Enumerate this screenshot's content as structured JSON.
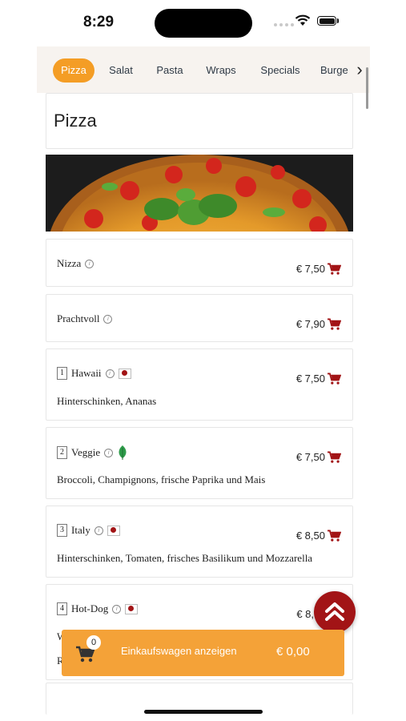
{
  "status_bar": {
    "time": "8:29"
  },
  "categories": [
    {
      "label": "Pizza",
      "active": true
    },
    {
      "label": "Salat",
      "active": false
    },
    {
      "label": "Pasta",
      "active": false
    },
    {
      "label": "Wraps",
      "active": false
    },
    {
      "label": "Specials",
      "active": false
    },
    {
      "label": "Burge",
      "active": false
    }
  ],
  "section": {
    "title": "Pizza"
  },
  "items": [
    {
      "name": "Nizza",
      "price": "€ 7,50"
    },
    {
      "name": "Prachtvoll",
      "price": "€ 7,90"
    },
    {
      "number": "1",
      "name": "Hawaii",
      "description": "Hinterschinken, Ananas",
      "price": "€ 7,50"
    },
    {
      "number": "2",
      "name": "Veggie",
      "description": "Broccoli, Champignons, frische Paprika und Mais",
      "price": "€ 7,50"
    },
    {
      "number": "3",
      "name": "Italy",
      "description": "Hinterschinken, Tomaten, frisches Basilikum und Mozzarella",
      "price": "€ 8,50"
    },
    {
      "number": "4",
      "name": "Hot-Dog",
      "description_partial": [
        "W",
        "R"
      ],
      "price": "€ 8,"
    }
  ],
  "basket": {
    "count": "0",
    "label": "Einkaufswagen anzeigen",
    "total": "€ 0,00"
  },
  "colors": {
    "accent": "#f49d25",
    "basket": "#f4a238",
    "brand_red": "#a21416"
  }
}
